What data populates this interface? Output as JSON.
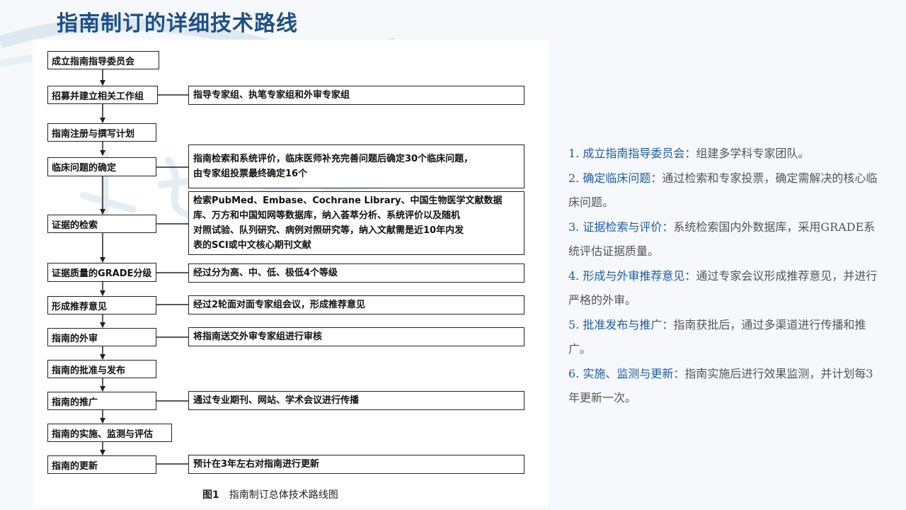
{
  "page": {
    "title": "指南制订的详细技术路线"
  },
  "flow": {
    "steps": [
      "成立指南指导委员会",
      "招募并建立相关工作组",
      "指南注册与撰写计划",
      "临床问题的确定",
      "证据的检索",
      "证据质量的GRADE分级",
      "形成推荐意见",
      "指南的外审",
      "指南的批准与发布",
      "指南的推广",
      "指南的实施、监测与评估",
      "指南的更新"
    ],
    "notes": {
      "workgroup": "指导专家组、执笔专家组和外审专家组",
      "question_line1": "指南检索和系统评价，临床医师补充完善问题后确定30个临床问题，",
      "question_line2": "由专家组投票最终确定16个",
      "search_line1": "检索PubMed、Embase、Cochrane Library、中国生物医学文献数据",
      "search_line2": "库、万方和中国知网等数据库，纳入荟萃分析、系统评价以及随机",
      "search_line3": "对照试验、队列研究、病例对照研究等，纳入文献需是近10年内发",
      "search_line4": "表的SCI或中文核心期刊文献",
      "grade": "经过分为高、中、低、极低4个等级",
      "recommend": "经过2轮面对面专家组会议，形成推荐意见",
      "review": "将指南送交外审专家组进行审核",
      "promote": "通过专业期刊、网站、学术会议进行传播",
      "update": "预计在3年左右对指南进行更新"
    },
    "caption_number": "图1",
    "caption_text": "指南制订总体技术路线图"
  },
  "description": {
    "items": [
      {
        "head": "1. 成立指南指导委员会：",
        "body": "组建多学科专家团队。"
      },
      {
        "head": "2. 确定临床问题：",
        "body": "通过检索和专家投票，确定需解决的核心临床问题。"
      },
      {
        "head": "3. 证据检索与评价：",
        "body": "系统检索国内外数据库，采用GRADE系统评估证据质量。"
      },
      {
        "head": "4. 形成与外审推荐意见：",
        "body": "通过专家会议形成推荐意见，并进行严格的外审。"
      },
      {
        "head": "5. 批准发布与推广：",
        "body": "指南获批后，通过多渠道进行传播和推广。"
      },
      {
        "head": "6. 实施、监测与更新：",
        "body": "指南实施后进行效果监测，并计划每3年更新一次。"
      }
    ]
  },
  "colors": {
    "title": "#1d4f86",
    "accent": "#1d5ea0",
    "body_text": "#555555"
  }
}
